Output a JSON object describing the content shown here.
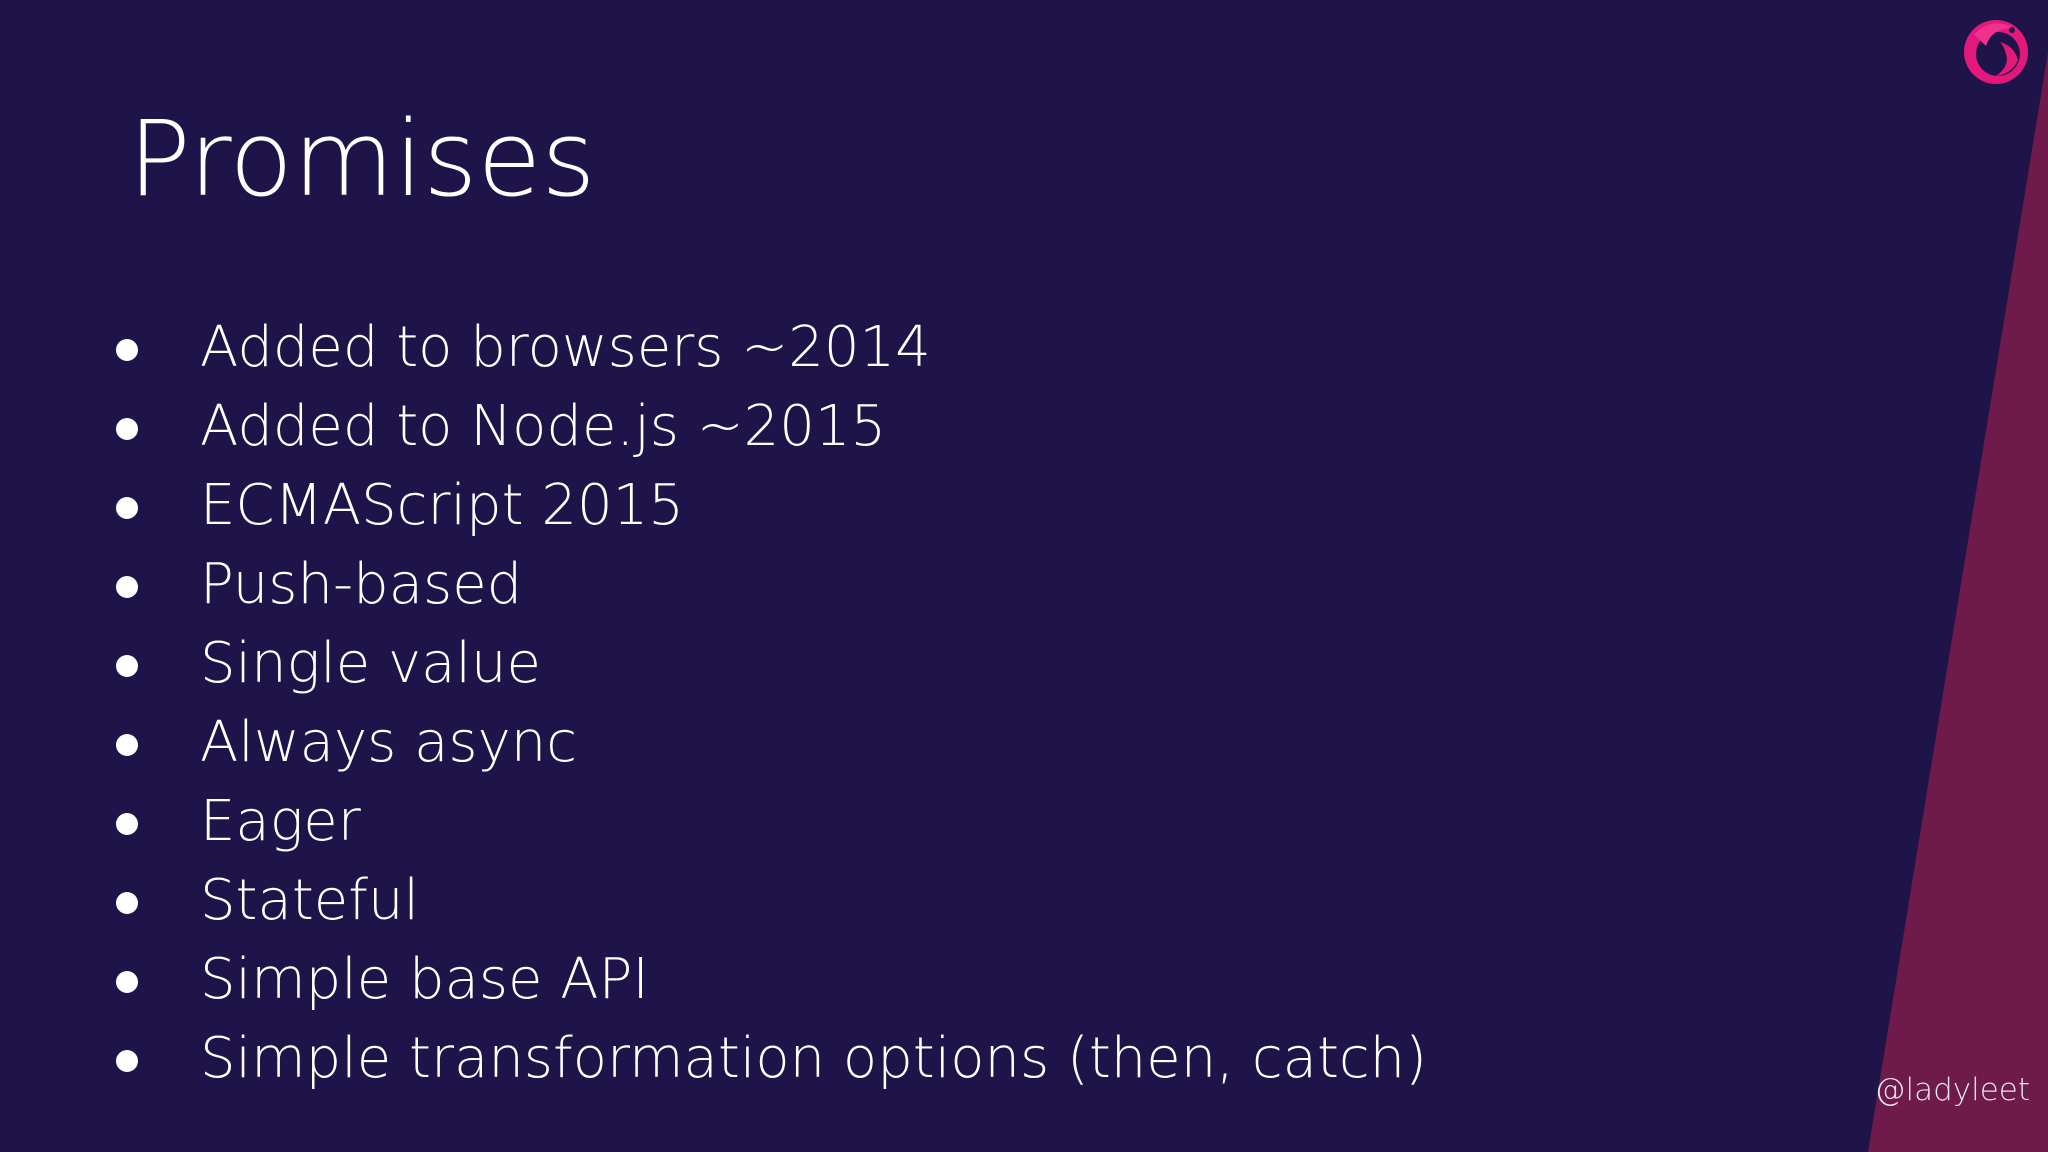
{
  "slide": {
    "title": "Promises",
    "bullets": [
      "Added to browsers ~2014",
      "Added to Node.js ~2015",
      "ECMAScript 2015",
      "Push-based",
      "Single value",
      "Always async",
      "Eager",
      "Stateful",
      "Simple base API",
      "Simple transformation options (then, catch)"
    ],
    "handle": "@ladyleet",
    "logo_icon": "rxjs-logo-icon"
  },
  "colors": {
    "background": "#1e1449",
    "accent_stripe": "#6e1a4a",
    "logo": "#e4177b",
    "text": "#ffffff"
  }
}
